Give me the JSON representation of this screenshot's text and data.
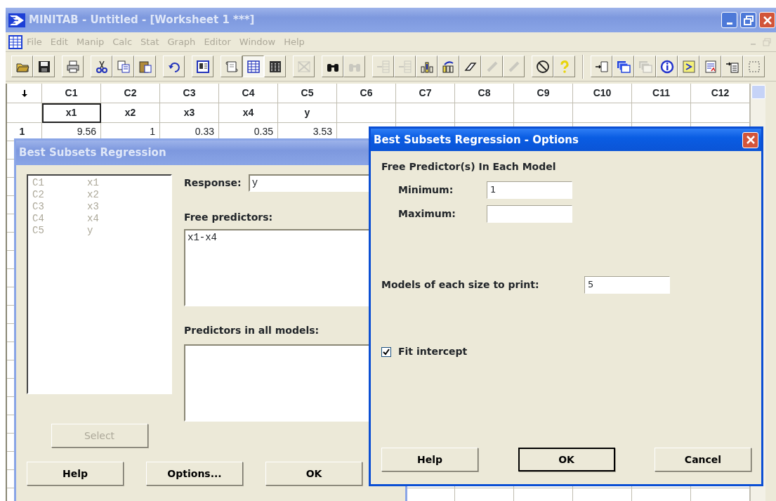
{
  "window": {
    "title": "MINITAB - Untitled - [Worksheet 1 ***]",
    "active": false
  },
  "menu": [
    "File",
    "Edit",
    "Manip",
    "Calc",
    "Stat",
    "Graph",
    "Editor",
    "Window",
    "Help"
  ],
  "toolbar": {
    "groups": [
      {
        "buttons": [
          {
            "disabled": false,
            "pressed": false
          },
          {
            "disabled": false,
            "pressed": false
          }
        ]
      },
      {
        "buttons": [
          {
            "disabled": false,
            "pressed": false
          }
        ]
      },
      {
        "buttons": [
          {
            "disabled": false,
            "pressed": false
          },
          {
            "disabled": false,
            "pressed": false
          },
          {
            "disabled": false,
            "pressed": false
          }
        ]
      },
      {
        "buttons": [
          {
            "disabled": false,
            "pressed": false
          }
        ]
      },
      {
        "buttons": [
          {
            "disabled": false,
            "pressed": false
          }
        ]
      },
      {
        "buttons": [
          {
            "disabled": false,
            "pressed": false
          },
          {
            "disabled": false,
            "pressed": true
          },
          {
            "disabled": false,
            "pressed": false
          }
        ]
      },
      {
        "buttons": [
          {
            "disabled": true,
            "pressed": false
          }
        ]
      },
      {
        "buttons": [
          {
            "disabled": false,
            "pressed": false
          },
          {
            "disabled": true,
            "pressed": false
          }
        ]
      },
      {
        "buttons": [
          {
            "disabled": true,
            "pressed": false
          },
          {
            "disabled": true,
            "pressed": false
          },
          {
            "disabled": false,
            "pressed": false
          },
          {
            "disabled": false,
            "pressed": false
          },
          {
            "disabled": false,
            "pressed": false
          },
          {
            "disabled": true,
            "pressed": false
          },
          {
            "disabled": true,
            "pressed": false
          }
        ]
      },
      {
        "buttons": [
          {
            "disabled": false,
            "pressed": false
          },
          {
            "disabled": false,
            "pressed": false
          }
        ]
      },
      {
        "buttons": [
          {
            "disabled": false,
            "pressed": false
          },
          {
            "disabled": false,
            "pressed": false
          },
          {
            "disabled": true,
            "pressed": false
          },
          {
            "disabled": false,
            "pressed": false
          },
          {
            "disabled": false,
            "pressed": false
          },
          {
            "disabled": false,
            "pressed": false
          },
          {
            "disabled": false,
            "pressed": false
          },
          {
            "disabled": false,
            "pressed": false
          }
        ]
      }
    ]
  },
  "worksheet": {
    "columns": [
      {
        "label": "C1",
        "name": "x1",
        "selected": true
      },
      {
        "label": "C2",
        "name": "x2",
        "selected": false
      },
      {
        "label": "C3",
        "name": "x3",
        "selected": false
      },
      {
        "label": "C4",
        "name": "x4",
        "selected": false
      },
      {
        "label": "C5",
        "name": "y",
        "selected": false
      },
      {
        "label": "C6",
        "selected": false
      },
      {
        "label": "C7",
        "selected": false
      },
      {
        "label": "C8",
        "selected": false
      },
      {
        "label": "C9",
        "selected": false
      },
      {
        "label": "C10",
        "selected": false
      },
      {
        "label": "C11",
        "selected": false
      },
      {
        "label": "C12",
        "selected": false
      }
    ],
    "rows": [
      {
        "number": "1",
        "cells": [
          "9.56",
          "1",
          "0.33",
          "0.35",
          "3.53"
        ]
      }
    ]
  },
  "subsets_dialog": {
    "title": "Best Subsets Regression",
    "active": false,
    "variables": [
      {
        "column": "C1",
        "name": "x1"
      },
      {
        "column": "C2",
        "name": "x2"
      },
      {
        "column": "C3",
        "name": "x3"
      },
      {
        "column": "C4",
        "name": "x4"
      },
      {
        "column": "C5",
        "name": "y"
      }
    ],
    "variables_disabled": true,
    "response_label": "Response:",
    "response": "y",
    "free_label": "Free predictors:",
    "free": "x1-x4",
    "all_label": "Predictors in all models:",
    "select": {
      "label": "Select",
      "disabled": true
    },
    "buttons": [
      "Help",
      "Options...",
      "OK"
    ]
  },
  "options_dialog": {
    "title": "Best Subsets Regression - Options",
    "active": true,
    "group_label": "Free Predictor(s) In Each Model",
    "fields": [
      {
        "label": "Minimum:",
        "value": "1"
      },
      {
        "label": "Maximum:"
      }
    ],
    "models": {
      "label": "Models of each size to print:",
      "value": "5"
    },
    "checkbox": {
      "label": "Fit intercept",
      "checked": true
    },
    "buttons": [
      {
        "label": "Help",
        "default": false
      },
      {
        "label": "OK",
        "default": true
      },
      {
        "label": "Cancel",
        "default": false
      }
    ]
  }
}
